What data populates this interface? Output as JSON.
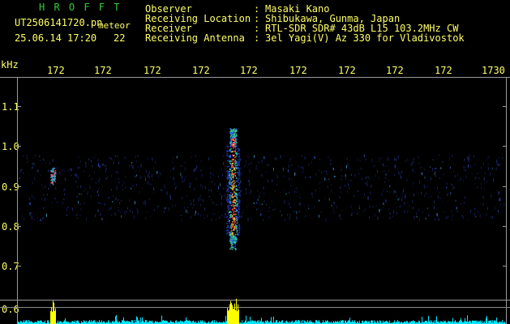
{
  "app": {
    "name": "H R O F F T",
    "file": "UT2506141720.pn",
    "mode": "meteor",
    "datetime": "25.06.14 17:20",
    "count": "22"
  },
  "header": {
    "rows": [
      {
        "label": "Observer",
        "sep": ":",
        "value": "Masaki Kano"
      },
      {
        "label": "Receiving Location",
        "sep": ":",
        "value": "Shibukawa, Gunma, Japan"
      },
      {
        "label": "Receiver",
        "sep": ":",
        "value": "RTL-SDR SDR# 43dB L15 103.2MHz CW"
      },
      {
        "label": "Receiving Antenna",
        "sep": ":",
        "value": "3el Yagi(V) Az 330 for Vladivostok"
      }
    ]
  },
  "axes": {
    "unit": "kHz",
    "x_ticks": [
      "172",
      "172",
      "172",
      "172",
      "172",
      "172",
      "172",
      "172",
      "172",
      "1730"
    ],
    "y_ticks": [
      "1.1",
      "1.0",
      "0.9",
      "0.8",
      "0.7",
      "0.6"
    ]
  },
  "colors": {
    "text": "#ffff66",
    "title": "#33cc33",
    "frame": "#aaaaaa",
    "signal_core": "#ff3333",
    "signal_mid": "#33cc99",
    "signal_low": "#2233aa",
    "bar_main": "#ffff00",
    "bar_noise": "#00e5ff"
  }
}
